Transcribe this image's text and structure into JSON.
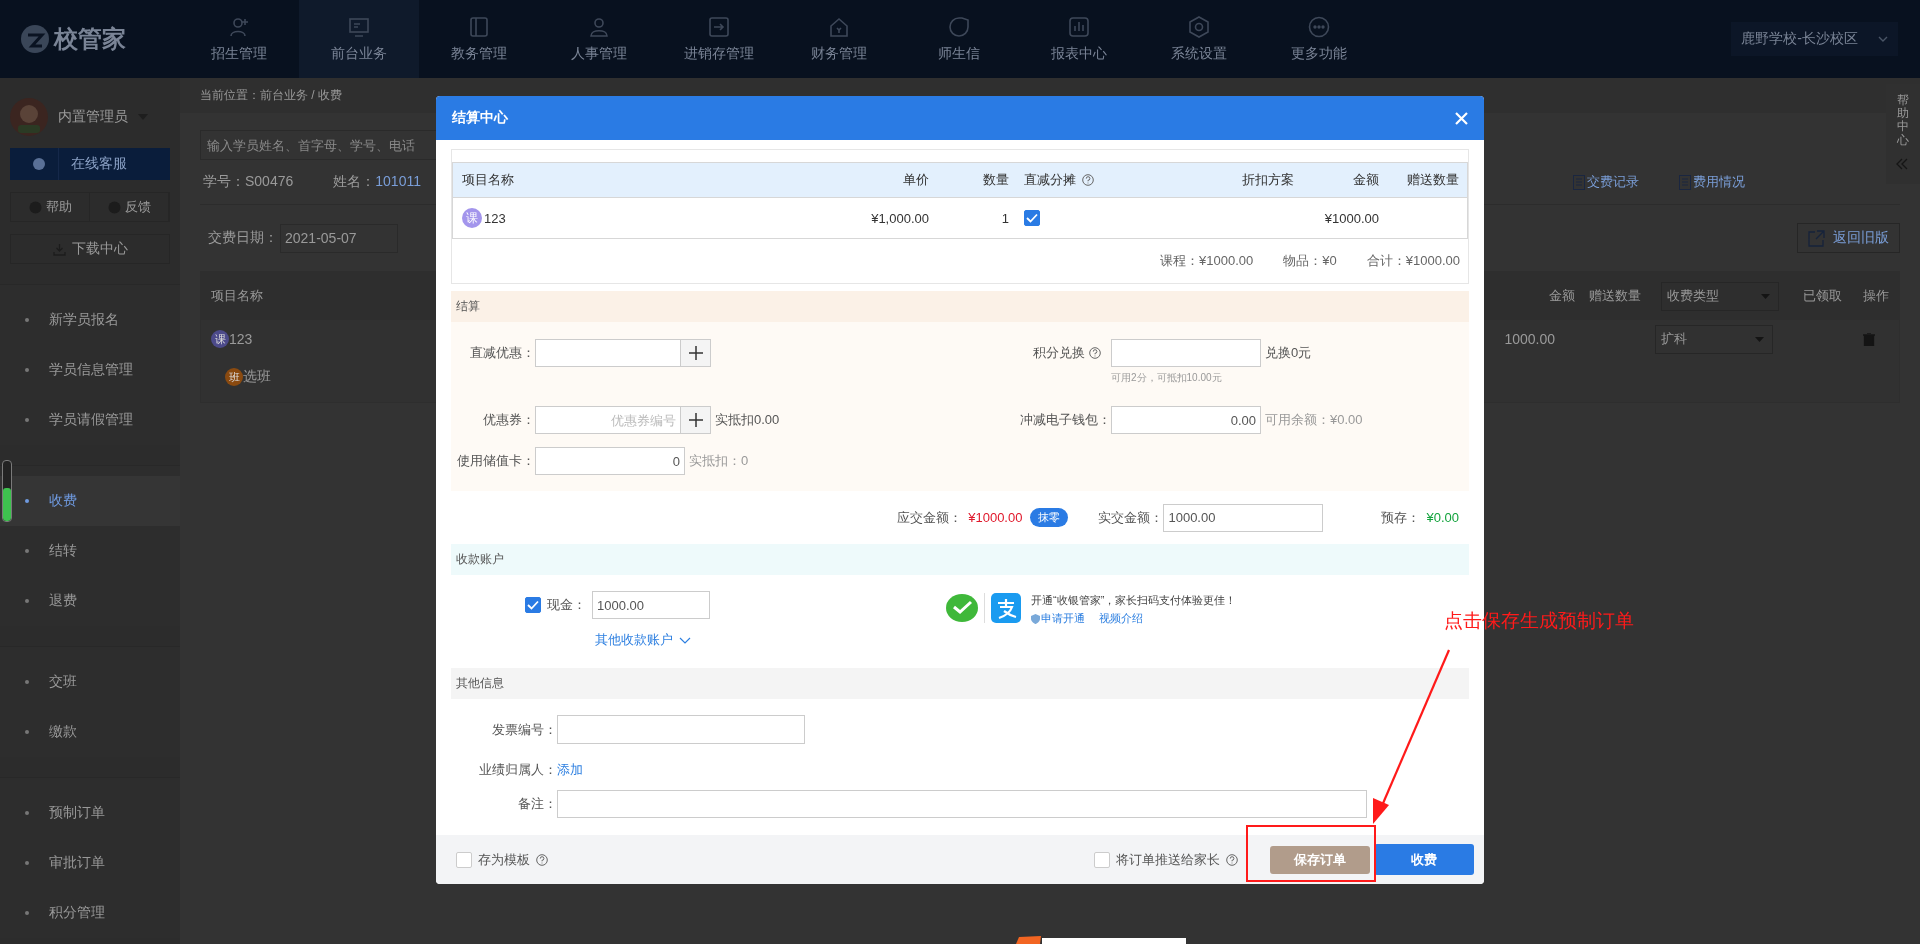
{
  "top_nav": {
    "logo": "校管家",
    "campus": "鹿野学校-长沙校区",
    "items": [
      {
        "label": "招生管理",
        "kind": "recruit",
        "selected": false
      },
      {
        "label": "前台业务",
        "kind": "desk",
        "selected": true
      },
      {
        "label": "教务管理",
        "kind": "book",
        "selected": false
      },
      {
        "label": "人事管理",
        "kind": "person",
        "selected": false
      },
      {
        "label": "进销存管理",
        "kind": "stock",
        "selected": false
      },
      {
        "label": "财务管理",
        "kind": "finance",
        "selected": false
      },
      {
        "label": "师生信",
        "kind": "chat",
        "selected": false
      },
      {
        "label": "报表中心",
        "kind": "report",
        "selected": false
      },
      {
        "label": "系统设置",
        "kind": "settings",
        "selected": false
      },
      {
        "label": "更多功能",
        "kind": "more",
        "selected": false
      }
    ]
  },
  "sidebar": {
    "user": "内置管理员",
    "service_button": "在线客服",
    "help_button": "帮助",
    "feedback_button": "反馈",
    "download_button": "下载中心",
    "groups": [
      {
        "items": [
          {
            "label": "新学员报名",
            "selected": false
          },
          {
            "label": "学员信息管理",
            "selected": false
          },
          {
            "label": "学员请假管理",
            "selected": false
          }
        ]
      },
      {
        "items": [
          {
            "label": "收费",
            "selected": true
          },
          {
            "label": "结转",
            "selected": false
          },
          {
            "label": "退费",
            "selected": false
          }
        ]
      },
      {
        "items": [
          {
            "label": "交班",
            "selected": false
          },
          {
            "label": "缴款",
            "selected": false
          }
        ]
      },
      {
        "items": [
          {
            "label": "预制订单",
            "selected": false
          },
          {
            "label": "审批订单",
            "selected": false
          },
          {
            "label": "积分管理",
            "selected": false
          }
        ]
      }
    ]
  },
  "side_gauge": {
    "level": 0.55
  },
  "help_tab": {
    "label": "帮助中心"
  },
  "main": {
    "breadcrumb": "当前位置：前台业务 / 收费",
    "search": {
      "placeholder": "输入学员姓名、首字母、学号、电话"
    },
    "student_id": "学号：S00476",
    "name_label": "姓名：",
    "name_value": "101011",
    "links": [
      "交费记录",
      "费用情况"
    ],
    "old_version_button": "返回旧版",
    "date_label": "交费日期：",
    "date": "2021-05-07",
    "table": {
      "columns": [
        "项目名称",
        "金额",
        "赠送数量",
        "收费类型",
        "已领取",
        "操作"
      ],
      "rows": [
        {
          "kind": "course",
          "badge": "课",
          "name": "123",
          "amount": "1000.00",
          "type": "扩科"
        },
        {
          "kind": "class",
          "badge": "班",
          "name": "选班"
        }
      ]
    }
  },
  "modal": {
    "title": "结算中心",
    "items": {
      "columns": [
        "项目名称",
        "单价",
        "数量",
        "直减分摊",
        "折扣方案",
        "金额",
        "赠送数量"
      ],
      "rows": [
        {
          "badge": "课",
          "name": "123",
          "price": "¥1,000.00",
          "qty": "1",
          "split": true,
          "amount": "¥1000.00"
        }
      ]
    },
    "summary": [
      "课程：¥1000.00",
      "物品：¥0",
      "合计：¥1000.00"
    ],
    "settle": {
      "title": "结算",
      "direct_label": "直减优惠：",
      "points_label": "积分兑换",
      "points_result": "兑换0元",
      "points_hint": "可用2分，可抵扣10.00元",
      "coupon_label": "优惠券：",
      "coupon_placeholder": "优惠券编号",
      "coupon_result": "实抵扣0.00",
      "wallet_label": "冲减电子钱包：",
      "wallet_value": "0.00",
      "wallet_result": "可用余额：¥0.00",
      "card_label": "使用储值卡：",
      "card_value": "0",
      "card_result": "实抵扣：0"
    },
    "totals": {
      "due_label": "应交金额：",
      "due": "¥1000.00",
      "round_button": "抹零",
      "paid_label": "实交金额：",
      "paid": "1000.00",
      "prestore_label": "预存：",
      "prestore": "¥0.00"
    },
    "account": {
      "title": "收款账户",
      "cash_checked": true,
      "cash_label": "现金：",
      "cash_value": "1000.00",
      "other_link": "其他收款账户",
      "promo": "开通“收银管家”，家长扫码支付体验更佳！",
      "apply_link": "申请开通",
      "video_link": "视频介绍"
    },
    "other": {
      "title": "其他信息",
      "invoice_label": "发票编号：",
      "owner_label": "业绩归属人：",
      "owner_link": "添加",
      "note_label": "备注："
    },
    "footer": {
      "template_label": "存为模板",
      "template_checked": false,
      "push_label": "将订单推送给家长",
      "push_checked": false,
      "save_button": "保存订单",
      "charge_button": "收费"
    }
  },
  "annotation": {
    "text": "点击保存生成预制订单"
  }
}
